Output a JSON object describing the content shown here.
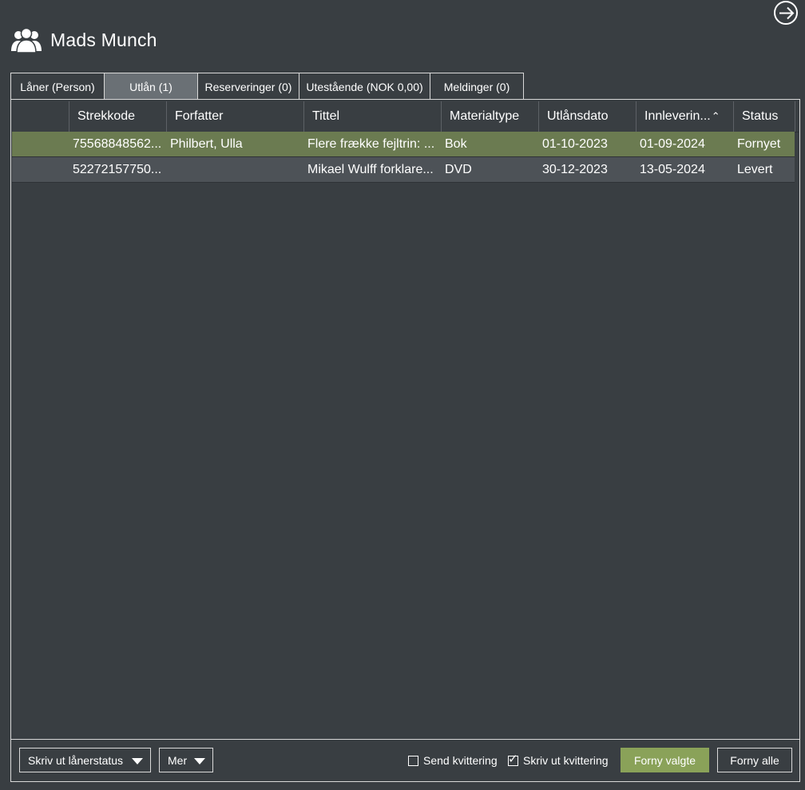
{
  "patron": {
    "name": "Mads Munch",
    "icon": "users-icon"
  },
  "tabs": [
    {
      "label": "Låner (Person)",
      "active": false
    },
    {
      "label": "Utlån (1)",
      "active": true
    },
    {
      "label": "Reserveringer (0)",
      "active": false
    },
    {
      "label": "Utestående (NOK 0,00)",
      "active": false
    },
    {
      "label": "Meldinger (0)",
      "active": false
    }
  ],
  "table": {
    "columns": [
      "",
      "Strekkode",
      "Forfatter",
      "Tittel",
      "Materialtype",
      "Utlånsdato",
      "Innleverin...",
      "Status"
    ],
    "sort_column": "Innleverin...",
    "sort_direction": "ascending",
    "rows": [
      {
        "barcode": "75568848562...",
        "author": "Philbert, Ulla",
        "title": "Flere frække fejltrin: ...",
        "material": "Bok",
        "loan_date": "01-10-2023",
        "due_date": "01-09-2024",
        "status": "Fornyet",
        "selected": true
      },
      {
        "barcode": "52272157750...",
        "author": "",
        "title": "Mikael Wulff forklare...",
        "material": "DVD",
        "loan_date": "30-12-2023",
        "due_date": "13-05-2024",
        "status": "Levert",
        "selected": false
      }
    ]
  },
  "footer": {
    "print_status_label": "Skriv ut lånerstatus",
    "more_label": "Mer",
    "send_receipt": {
      "label": "Send kvittering",
      "checked": false
    },
    "print_receipt": {
      "label": "Skriv ut kvittering",
      "checked": true
    },
    "renew_selected_label": "Forny valgte",
    "renew_all_label": "Forny alle"
  },
  "colors": {
    "background": "#393e42",
    "selected_row": "#6b7b51",
    "row": "#4d5257",
    "active_tab": "#6a7075",
    "primary_button": "#8aa259"
  }
}
